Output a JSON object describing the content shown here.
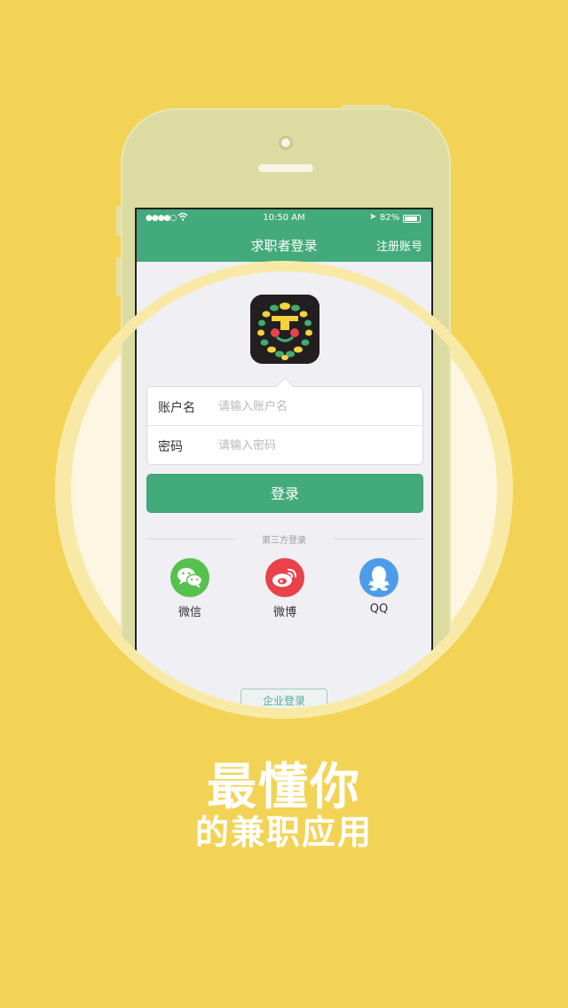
{
  "colors": {
    "background": "#f2d355",
    "accent_green": "#43aa7b",
    "wechat": "#57c14d",
    "weibo": "#e9424b",
    "qq": "#4d9ce8"
  },
  "status_bar": {
    "signal": "●●●●○",
    "wifi_icon": "wifi-icon",
    "time": "10:50 AM",
    "location_icon": "location-arrow-icon",
    "battery_pct": "82%"
  },
  "nav": {
    "title": "求职者登录",
    "register": "注册账号"
  },
  "form": {
    "account_label": "账户名",
    "account_placeholder": "请输入账户名",
    "password_label": "密码",
    "password_placeholder": "请输入密码"
  },
  "login_button": "登录",
  "third_party": {
    "label": "第三方登录",
    "items": [
      {
        "label": "微信",
        "icon": "wechat-icon"
      },
      {
        "label": "微博",
        "icon": "weibo-icon"
      },
      {
        "label": "QQ",
        "icon": "qq-icon"
      }
    ]
  },
  "enterprise_button": "企业登录",
  "tagline": {
    "line1": "最懂你",
    "line2": "的兼职应用"
  }
}
